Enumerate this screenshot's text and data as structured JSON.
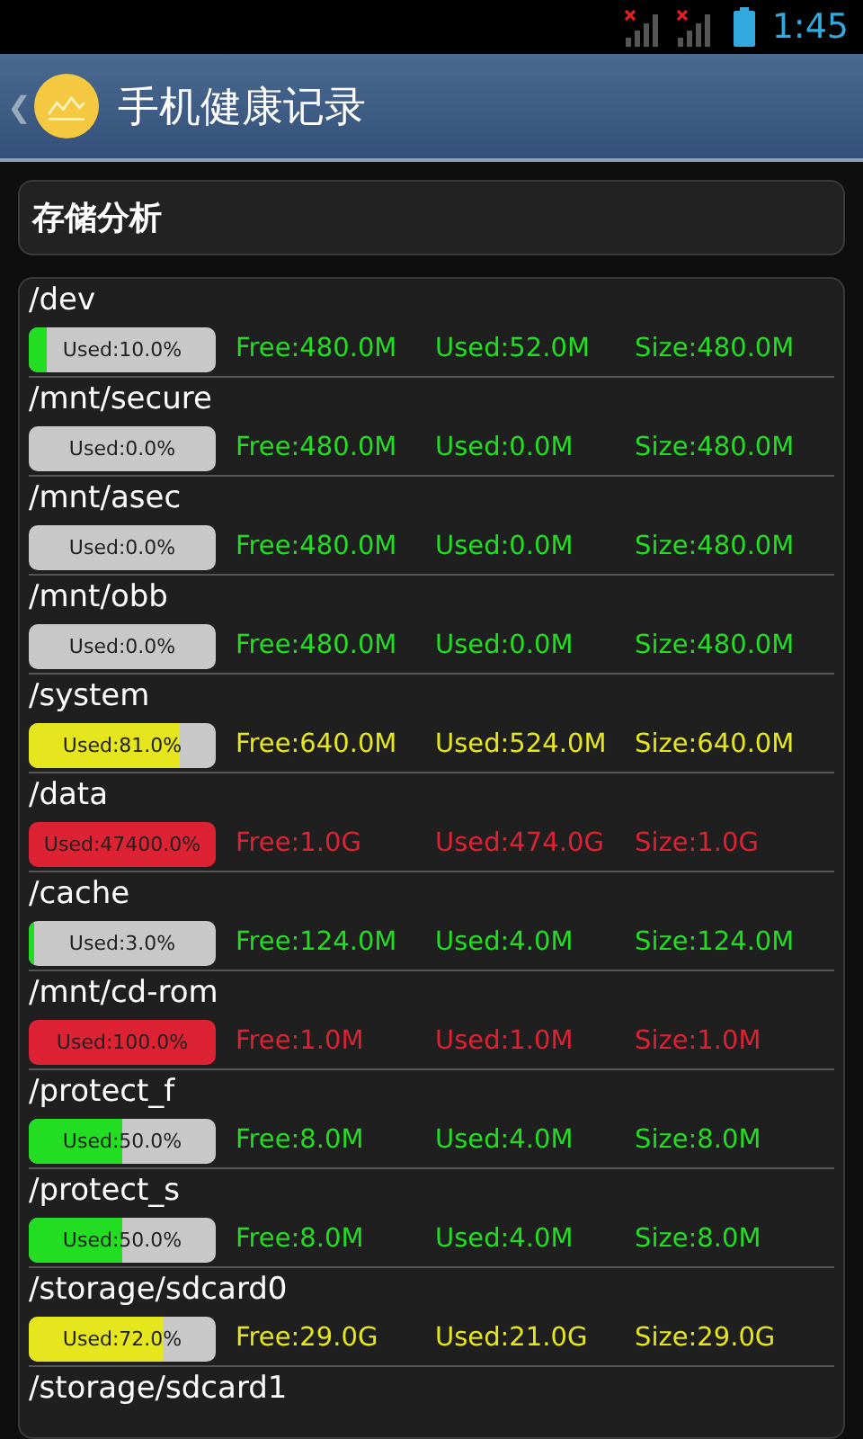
{
  "status_bar": {
    "time": "1:45"
  },
  "header": {
    "back": "❮",
    "title": "手机健康记录"
  },
  "section": {
    "title": "存储分析"
  },
  "rows": [
    {
      "path": "/dev",
      "used_pct": "Used:10.0%",
      "level": 0.1,
      "color": "#22dd22",
      "free": "Free:480.0M",
      "used": "Used:52.0M",
      "size": "Size:480.0M"
    },
    {
      "path": "/mnt/secure",
      "used_pct": "Used:0.0%",
      "color": "#22dd22",
      "free": "Free:480.0M",
      "used": "Used:0.0M",
      "size": "Size:480.0M"
    },
    {
      "path": "/mnt/asec",
      "used_pct": "Used:0.0%",
      "color": "#22dd22",
      "free": "Free:480.0M",
      "used": "Used:0.0M",
      "size": "Size:480.0M"
    },
    {
      "path": "/mnt/obb",
      "used_pct": "Used:0.0%",
      "color": "#22dd22",
      "free": "Free:480.0M",
      "used": "Used:0.0M",
      "size": "Size:480.0M"
    },
    {
      "path": "/system",
      "used_pct": "Used:81.0%",
      "level": 0.81,
      "color": "#e6e61e",
      "free": "Free:640.0M",
      "used": "Used:524.0M",
      "size": "Size:640.0M"
    },
    {
      "path": "/data",
      "used_pct": "Used:47400.0%",
      "level": 1,
      "color": "#dd2233",
      "free": "Free:1.0G",
      "used": "Used:474.0G",
      "size": "Size:1.0G"
    },
    {
      "path": "/cache",
      "used_pct": "Used:3.0%",
      "level": 0.03,
      "color": "#22dd22",
      "free": "Free:124.0M",
      "used": "Used:4.0M",
      "size": "Size:124.0M"
    },
    {
      "path": "/mnt/cd-rom",
      "used_pct": "Used:100.0%",
      "level": 1,
      "color": "#dd2233",
      "free": "Free:1.0M",
      "used": "Used:1.0M",
      "size": "Size:1.0M"
    },
    {
      "path": "/protect_f",
      "used_pct": "Used:50.0%",
      "level": 0.5,
      "color": "#22dd22",
      "free": "Free:8.0M",
      "used": "Used:4.0M",
      "size": "Size:8.0M"
    },
    {
      "path": "/protect_s",
      "used_pct": "Used:50.0%",
      "level": 0.5,
      "color": "#22dd22",
      "free": "Free:8.0M",
      "used": "Used:4.0M",
      "size": "Size:8.0M"
    },
    {
      "path": "/storage/sdcard0",
      "used_pct": "Used:72.0%",
      "level": 0.72,
      "color": "#e6e61e",
      "free": "Free:29.0G",
      "used": "Used:21.0G",
      "size": "Size:29.0G"
    },
    {
      "path": "/storage/sdcard1"
    }
  ]
}
